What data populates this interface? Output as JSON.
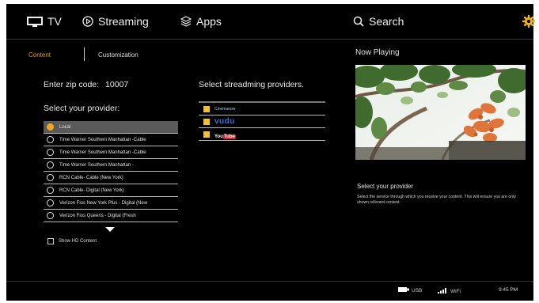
{
  "nav": {
    "tv": "TV",
    "streaming": "Streaming",
    "apps": "Apps",
    "search": "Search",
    "icons": {
      "tv": "tv-icon",
      "streaming": "play-circle-icon",
      "apps": "stack-icon",
      "search": "search-icon",
      "settings": "gear-icon"
    }
  },
  "tabs": {
    "content": "Content",
    "customization": "Customization"
  },
  "left": {
    "zip_label": "Enter zip code:",
    "zip_value": "10007",
    "provider_heading": "Select your provider:",
    "providers": [
      "Local",
      "Time Warner Southern Manhattan -Cable",
      "Time Warner Southern Manhattan -Cable",
      "Time Warner Southern Manhattan -",
      "RCN Cable- Cable (New York)",
      "RCN Cable- Digital (New York)",
      "Verizon Fios New York Plus - Digital (New",
      "Verizon Fios Queens - Digital (Fresh"
    ],
    "selected_index": 0,
    "hd_label": "Show HD Content"
  },
  "streaming": {
    "heading": "Select streadming providers.",
    "providers": [
      "Cinemanow",
      "vudu",
      "YouTube"
    ],
    "youtube_you": "You",
    "youtube_tube": "Tube"
  },
  "now_playing": {
    "heading": "Now Playing",
    "select_title": "Select your provider",
    "description": "Select the service through which you receive your content. This will ensure you are only shown relevant content."
  },
  "status": {
    "usb": "USB",
    "wifi": "WiFi",
    "time": "9:45 PM"
  },
  "colors": {
    "accent": "#f1a623",
    "background": "#000000",
    "selected_row": "#5a5a5a"
  }
}
